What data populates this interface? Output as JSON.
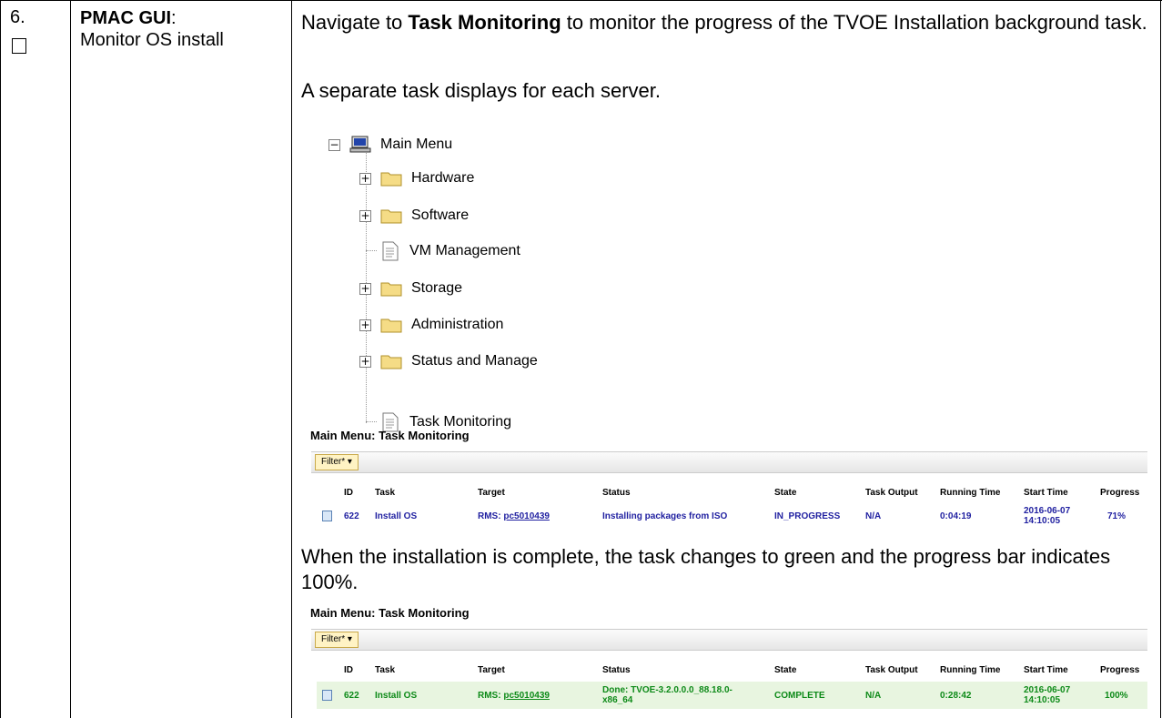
{
  "step": {
    "number": "6.",
    "title_bold": "PMAC GUI",
    "title_colon": ":",
    "subtitle": "Monitor OS install"
  },
  "instructions": {
    "p1_pre": "Navigate to ",
    "p1_bold": "Task Monitoring",
    "p1_post": " to monitor the progress of the TVOE Installation background task.",
    "p2": "A separate task displays for each server.",
    "p3": "When the installation is complete, the task changes to green and the progress bar indicates 100%."
  },
  "tree": {
    "root": "Main Menu",
    "items": [
      {
        "label": "Hardware",
        "type": "folder",
        "expander": "+"
      },
      {
        "label": "Software",
        "type": "folder",
        "expander": "+"
      },
      {
        "label": "VM Management",
        "type": "page"
      },
      {
        "label": "Storage",
        "type": "folder",
        "expander": "+"
      },
      {
        "label": "Administration",
        "type": "folder",
        "expander": "+"
      },
      {
        "label": "Status and Manage",
        "type": "folder",
        "expander": "+"
      },
      {
        "label": "Task Monitoring",
        "type": "page"
      }
    ],
    "root_expander": "−"
  },
  "task_panel_1": {
    "title": "Main Menu: Task Monitoring",
    "filter_label": "Filter*",
    "headers": [
      "ID",
      "Task",
      "Target",
      "Status",
      "State",
      "Task Output",
      "Running Time",
      "Start Time",
      "Progress"
    ],
    "row": {
      "id": "622",
      "task": "Install OS",
      "target_prefix": "RMS: ",
      "target_link": "pc5010439",
      "status": "Installing packages from ISO",
      "state": "IN_PROGRESS",
      "task_output": "N/A",
      "running_time": "0:04:19",
      "start_date": "2016-06-07",
      "start_time": "14:10:05",
      "progress": "71%"
    }
  },
  "task_panel_2": {
    "title": "Main Menu: Task Monitoring",
    "filter_label": "Filter*",
    "headers": [
      "ID",
      "Task",
      "Target",
      "Status",
      "State",
      "Task Output",
      "Running Time",
      "Start Time",
      "Progress"
    ],
    "row": {
      "id": "622",
      "task": "Install OS",
      "target_prefix": "RMS: ",
      "target_link": "pc5010439",
      "status_line1": "Done: TVOE-3.2.0.0.0_88.18.0-",
      "status_line2": "x86_64",
      "state": "COMPLETE",
      "task_output": "N/A",
      "running_time": "0:28:42",
      "start_date": "2016-06-07",
      "start_time": "14:10:05",
      "progress": "100%"
    }
  },
  "colors": {
    "in_progress_text": "#1f1fa0",
    "complete_text": "#0d8a18",
    "complete_row_bg": "#e8f5e0",
    "filter_bg": "#fff3c4"
  }
}
